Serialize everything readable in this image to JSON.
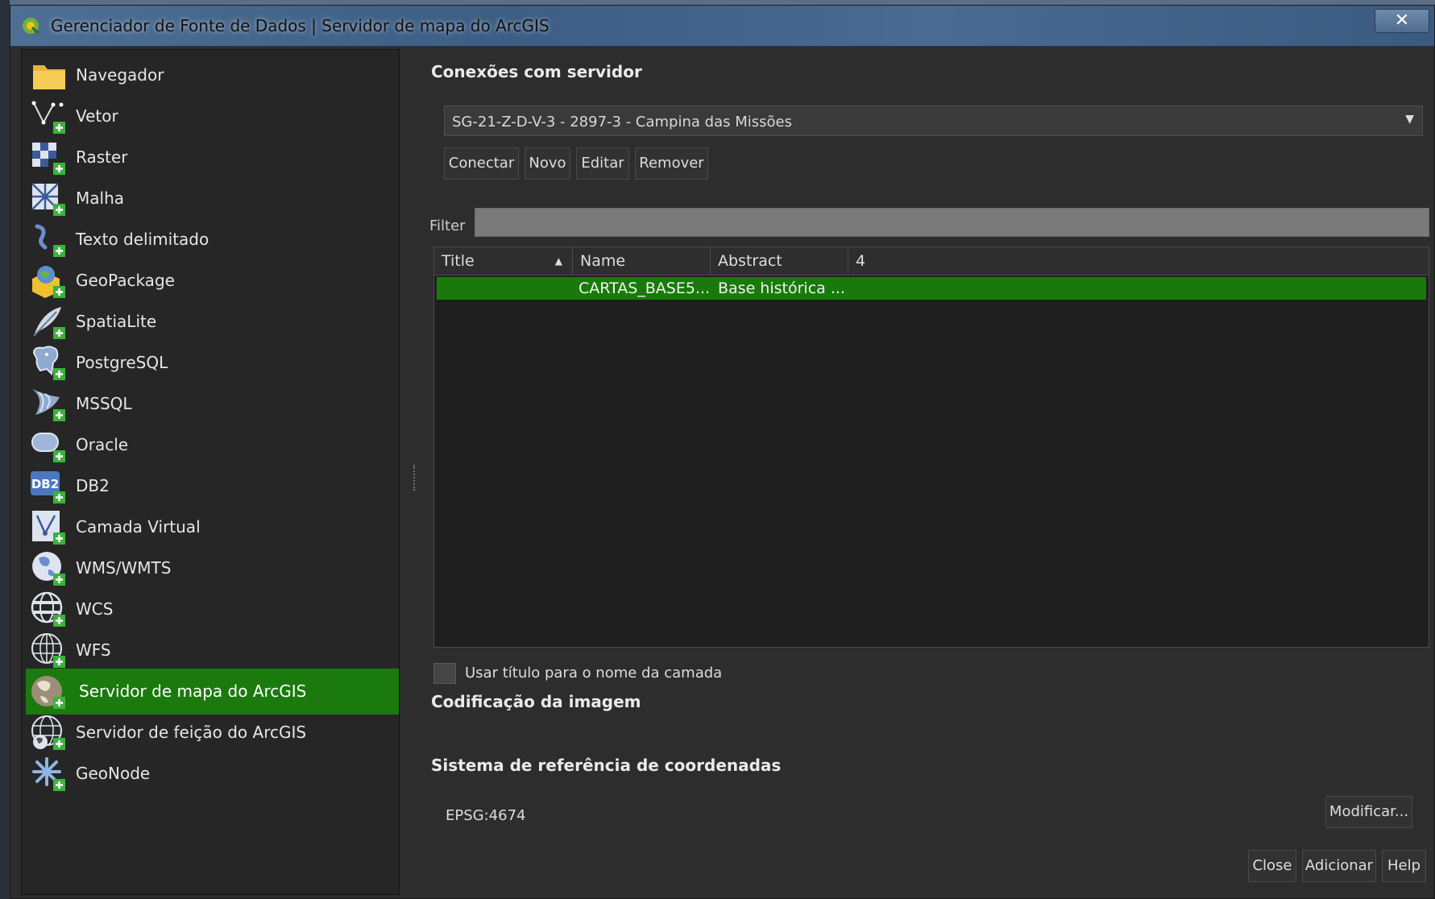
{
  "window": {
    "title": "Gerenciador de Fonte de Dados | Servidor de mapa do ArcGIS",
    "close_label": "✕"
  },
  "sidebar": {
    "items": [
      {
        "label": "Navegador",
        "icon": "folder-icon"
      },
      {
        "label": "Vetor",
        "icon": "vector-icon"
      },
      {
        "label": "Raster",
        "icon": "raster-icon"
      },
      {
        "label": "Malha",
        "icon": "mesh-icon"
      },
      {
        "label": "Texto delimitado",
        "icon": "delimited-text-icon"
      },
      {
        "label": "GeoPackage",
        "icon": "geopackage-icon"
      },
      {
        "label": "SpatiaLite",
        "icon": "spatialite-icon"
      },
      {
        "label": "PostgreSQL",
        "icon": "postgresql-icon"
      },
      {
        "label": "MSSQL",
        "icon": "mssql-icon"
      },
      {
        "label": "Oracle",
        "icon": "oracle-icon"
      },
      {
        "label": "DB2",
        "icon": "db2-icon"
      },
      {
        "label": "Camada Virtual",
        "icon": "virtual-layer-icon"
      },
      {
        "label": "WMS/WMTS",
        "icon": "wms-icon"
      },
      {
        "label": "WCS",
        "icon": "wcs-icon"
      },
      {
        "label": "WFS",
        "icon": "wfs-icon"
      },
      {
        "label": "Servidor de mapa do ArcGIS",
        "icon": "arcgis-map-server-icon",
        "selected": true
      },
      {
        "label": "Servidor de feição do ArcGIS",
        "icon": "arcgis-feature-server-icon"
      },
      {
        "label": "GeoNode",
        "icon": "geonode-icon"
      }
    ]
  },
  "connections": {
    "heading": "Conexões com servidor",
    "selected": "SG-21-Z-D-V-3 - 2897-3 - Campina das Missões",
    "buttons": {
      "connect": "Conectar",
      "new": "Novo",
      "edit": "Editar",
      "remove": "Remover"
    }
  },
  "filter": {
    "label": "Filter",
    "value": ""
  },
  "table": {
    "columns": [
      "Title",
      "Name",
      "Abstract",
      "4"
    ],
    "rows": [
      {
        "title": "",
        "name": "CARTAS_BASE5...",
        "abstract": "Base histórica ..."
      }
    ]
  },
  "use_title_label": "Usar título para o nome da camada",
  "use_title_checked": false,
  "image_encoding_heading": "Codificação da imagem",
  "crs": {
    "heading": "Sistema de referência de coordenadas",
    "value": "EPSG:4674",
    "modify_label": "Modificar..."
  },
  "footer": {
    "close": "Close",
    "add": "Adicionar",
    "help": "Help"
  },
  "colors": {
    "selection": "#1b7a0d",
    "background": "#2d2d2d",
    "accent_plus": "#3bb33b"
  }
}
